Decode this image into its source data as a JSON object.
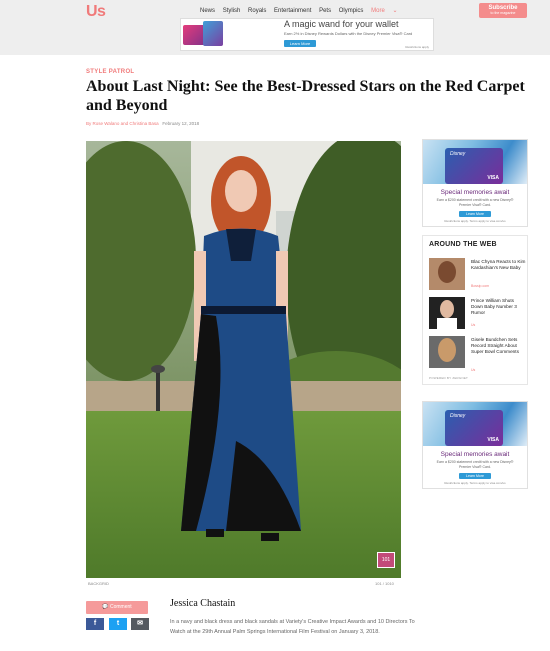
{
  "header": {
    "logo": "Us",
    "nav": [
      "News",
      "Stylish",
      "Royals",
      "Entertainment",
      "Pets",
      "Olympics"
    ],
    "more": "More",
    "subscribe_label": "Subscribe",
    "subscribe_sub": "to the magazine"
  },
  "top_ad": {
    "headline": "A magic wand for your wallet",
    "fine_print": "Earn 2% in Disney Rewards Dollars with the Disney Premier Visa® Card",
    "button": "Learn More",
    "tiny": "Restrictions apply"
  },
  "article": {
    "kicker": "STYLE PATROL",
    "title": "About Last Night: See the Best-Dressed Stars on the Red Carpet and Beyond",
    "authors": "By Rose Walano and Christina Basa",
    "date": "February 12, 2018",
    "photo_credit": "BACKGRID",
    "photo_count": "101 / 1010",
    "badge": "101"
  },
  "caption": {
    "name": "Jessica Chastain",
    "text": "In a navy and black dress and black sandals at Variety's Creative Impact Awards and 10 Directors To Watch at the 29th Annual Palm Springs International Film Festival on January 3, 2018."
  },
  "share": {
    "comment_label": "Comment",
    "facebook": "f",
    "twitter": "t",
    "email": "✉"
  },
  "side_ad": {
    "logo": "Disney",
    "brand": "VISA",
    "headline": "Special memories await",
    "fine_print": "Earn a $200 statement credit with a new Disney® Premier Visa® Card.",
    "button": "Learn More",
    "tiny": "Restrictions apply. Terms apply to visa.com/us"
  },
  "around_the_web": {
    "heading": "AROUND THE WEB",
    "items": [
      {
        "title": "Blac Chyna Reacts to Kim Kardashian's New Baby",
        "source": "Bossip.com"
      },
      {
        "title": "Prince William Shuts Down Baby Number 3 Rumor",
        "source": "Us"
      },
      {
        "title": "Gisele Bundchen Sets Record Straight About Super Bowl Comments",
        "source": "Us"
      }
    ],
    "powered_by": "POWERED BY ZERGNET"
  },
  "colors": {
    "brand": "#f07a7a",
    "facebook": "#3b5998",
    "twitter": "#1da1f2"
  }
}
